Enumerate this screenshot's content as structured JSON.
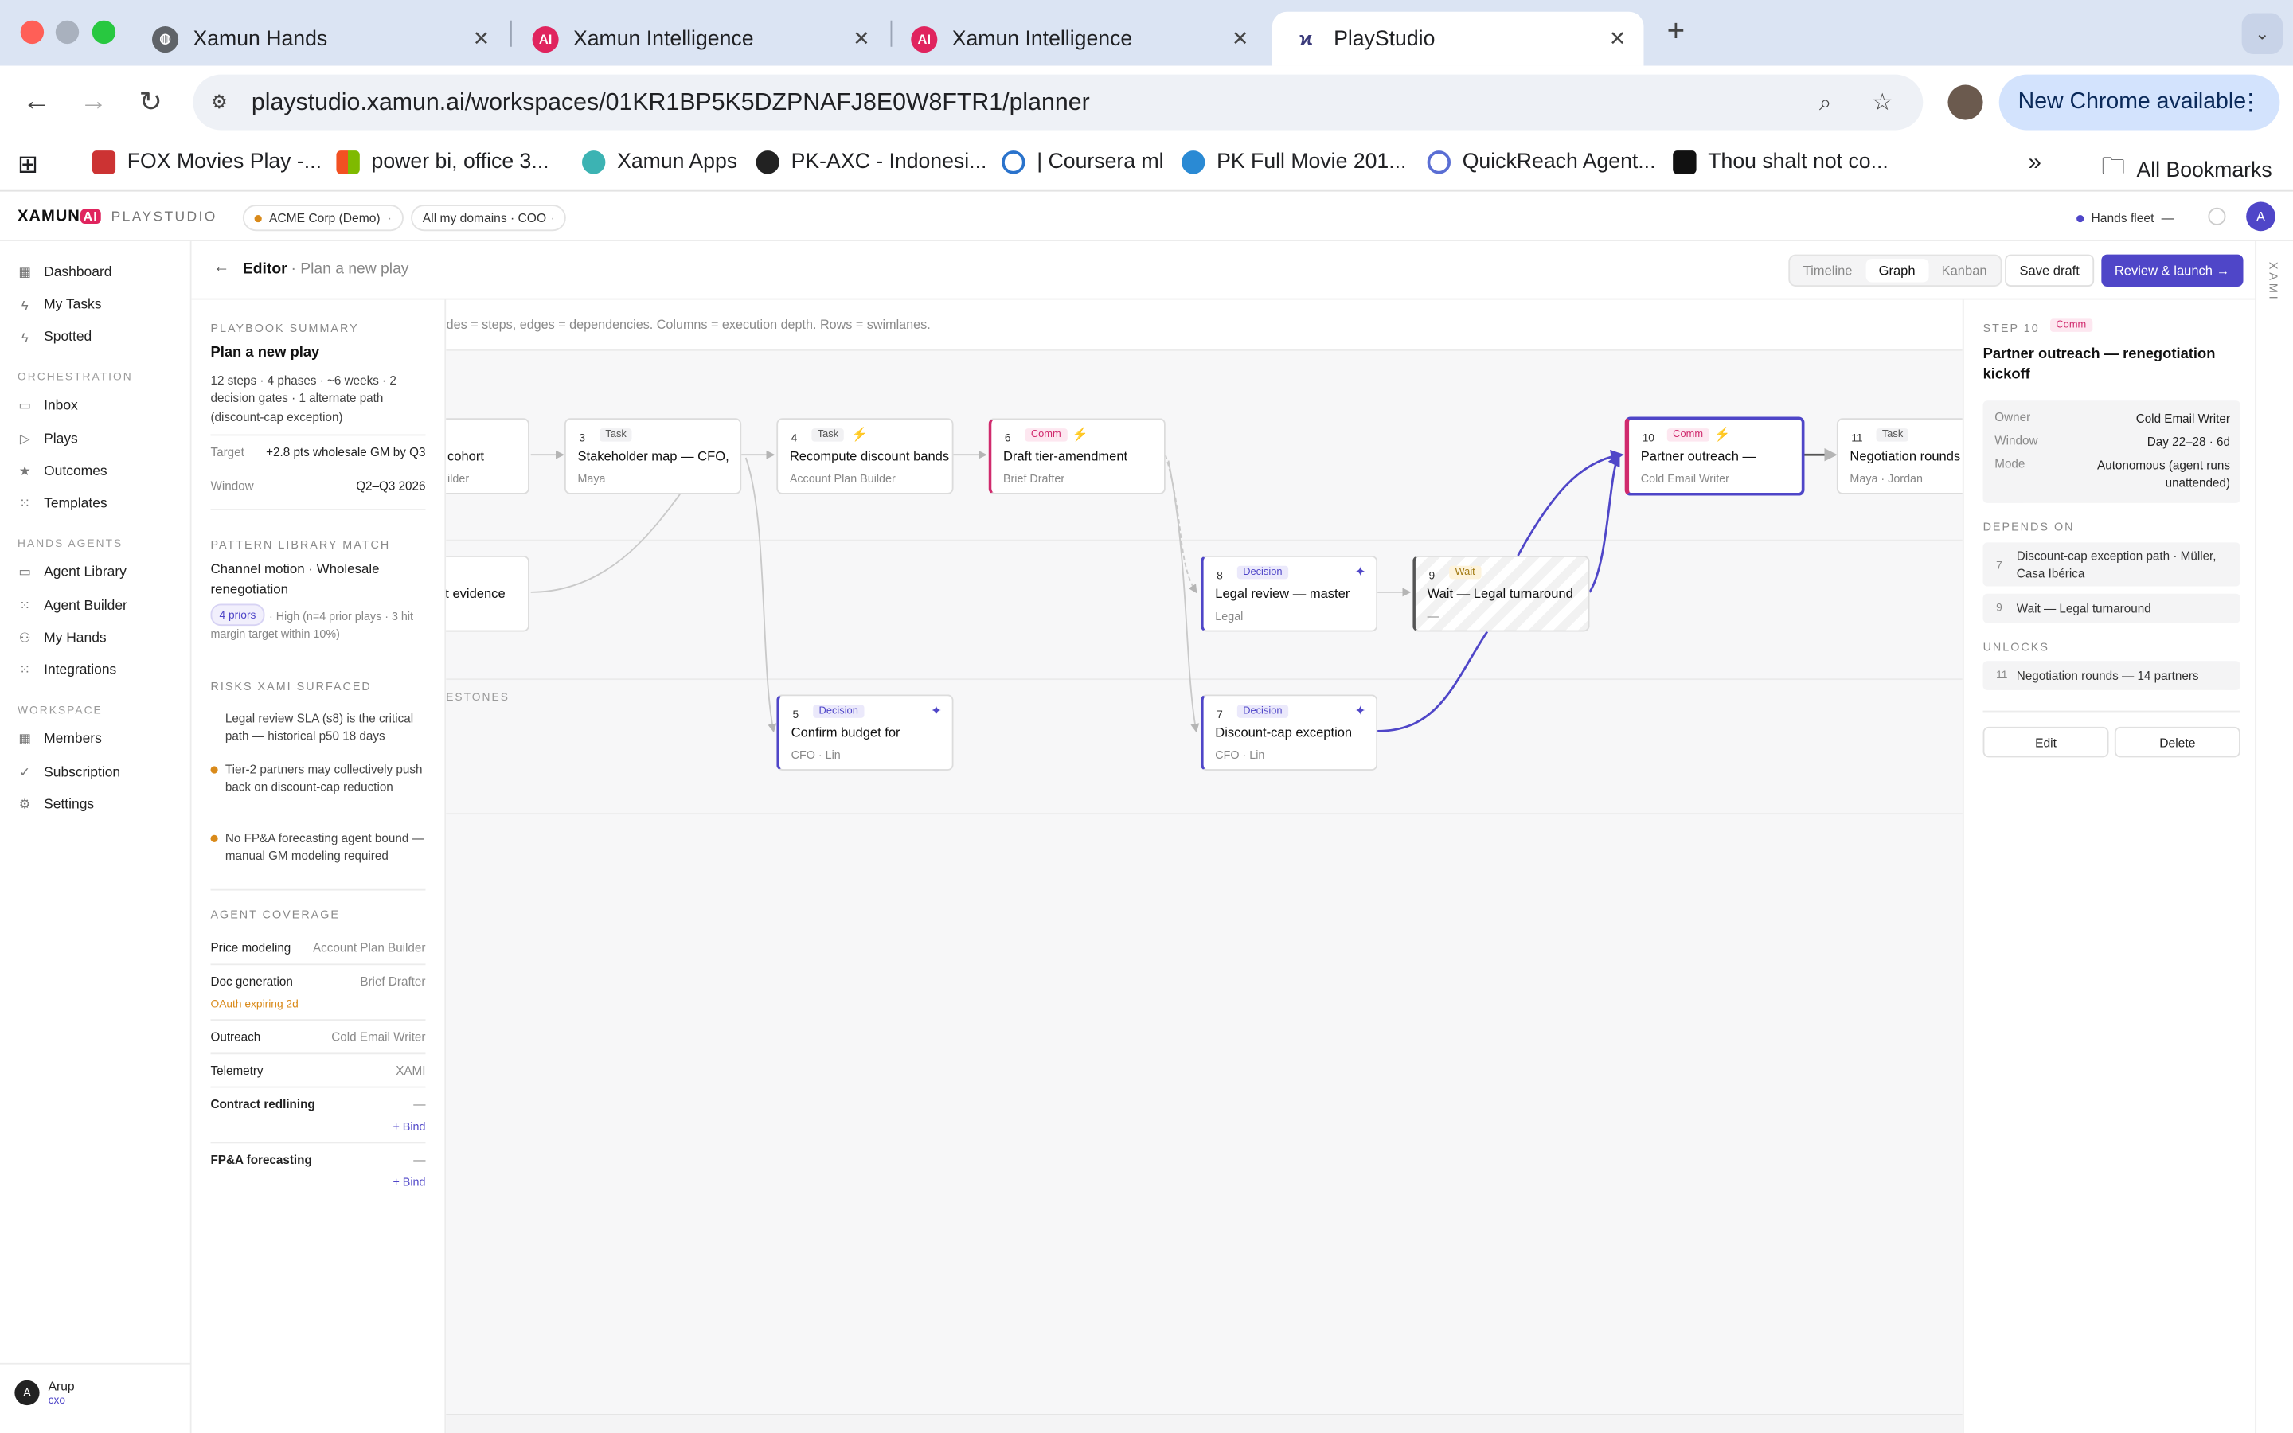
{
  "browser": {
    "tabs": [
      {
        "title": "Xamun Hands"
      },
      {
        "title": "Xamun Intelligence"
      },
      {
        "title": "Xamun Intelligence"
      },
      {
        "title": "PlayStudio"
      }
    ],
    "url": "playstudio.xamun.ai/workspaces/01KR1BP5K5DZPNAFJ8E0W8FTR1/planner",
    "new_chrome_label": "New Chrome available",
    "bookmarks": [
      "FOX Movies Play -...",
      "power bi, office 3...",
      "Xamun Apps",
      "PK-AXC - Indonesi...",
      "| Coursera ml",
      "PK Full Movie 201...",
      "QuickReach Agent...",
      "Thou shalt not co..."
    ],
    "all_bookmarks_label": "All Bookmarks"
  },
  "app": {
    "logo": "XAMUN",
    "logo_ai": "AI",
    "name": "PLAYSTUDIO",
    "org_chip": "ACME Corp (Demo)",
    "domain_chip": "All my domains · COO",
    "hands_fleet": "Hands fleet",
    "hands_fleet_value": "—",
    "avatar_letter": "A"
  },
  "sidebar": {
    "top": [
      {
        "label": "Dashboard",
        "icon": "grid-icon"
      },
      {
        "label": "My Tasks",
        "icon": "bolt-icon"
      },
      {
        "label": "Spotted",
        "icon": "bolt-icon"
      }
    ],
    "orchestration_header": "ORCHESTRATION",
    "orchestration": [
      {
        "label": "Inbox"
      },
      {
        "label": "Plays"
      },
      {
        "label": "Outcomes"
      },
      {
        "label": "Templates"
      }
    ],
    "hands_header": "HANDS AGENTS",
    "hands": [
      {
        "label": "Agent Library"
      },
      {
        "label": "Agent Builder"
      },
      {
        "label": "My Hands"
      },
      {
        "label": "Integrations"
      }
    ],
    "workspace_header": "WORKSPACE",
    "workspace": [
      {
        "label": "Members"
      },
      {
        "label": "Subscription"
      },
      {
        "label": "Settings"
      }
    ],
    "user": {
      "initial": "A",
      "name": "Arup",
      "role": "cxo"
    }
  },
  "editor": {
    "title": "Editor",
    "subtitle": "· Plan a new play",
    "views": [
      "Timeline",
      "Graph",
      "Kanban"
    ],
    "save_label": "Save draft",
    "launch_label": "Review & launch →"
  },
  "summary": {
    "header": "PLAYBOOK SUMMARY",
    "title": "Plan a new play",
    "description": "12 steps · 4 phases · ~6 weeks · 2 decision gates · 1 alternate path (discount-cap exception)",
    "target_label": "Target",
    "target_value": "+2.8 pts wholesale GM by Q3",
    "window_label": "Window",
    "window_value": "Q2–Q3 2026",
    "pattern_header": "PATTERN LIBRARY MATCH",
    "pattern_title": "Channel motion · Wholesale renegotiation",
    "priors_badge": "4 priors",
    "priors_text": "· High (n=4 prior plays · 3 hit margin target within 10%)",
    "risks_header": "RISKS XAMI SURFACED",
    "risks": [
      "Legal review SLA (s8) is the critical path — historical p50 18 days",
      "Tier-2 partners may collectively push back on discount-cap reduction",
      "No FP&A forecasting agent bound — manual GM modeling required"
    ],
    "coverage_header": "AGENT COVERAGE",
    "coverage": [
      {
        "name": "Price modeling",
        "agent": "Account Plan Builder"
      },
      {
        "name": "Doc generation",
        "agent": "Brief Drafter",
        "note": "OAuth expiring 2d"
      },
      {
        "name": "Outreach",
        "agent": "Cold Email Writer"
      },
      {
        "name": "Telemetry",
        "agent": "XAMI"
      },
      {
        "name": "Contract redlining",
        "agent": "—",
        "bind": "+ Bind"
      },
      {
        "name": "FP&A forecasting",
        "agent": "—",
        "bind": "+ Bind"
      }
    ]
  },
  "canvas": {
    "hint": "Nodes = steps, edges = dependencies. Columns = execution depth. Rows = swimlanes.",
    "lane_labels": [
      "ESTONES"
    ],
    "nodes": [
      {
        "num": "",
        "tag": "",
        "title": "cohort",
        "sub": "ilder"
      },
      {
        "num": "3",
        "tag": "Task",
        "title": "Stakeholder map — CFO,",
        "sub": "Maya"
      },
      {
        "num": "4",
        "tag": "Task",
        "title": "Recompute discount bands",
        "sub": "Account Plan Builder"
      },
      {
        "num": "6",
        "tag": "Comm",
        "title": "Draft tier-amendment",
        "sub": "Brief Drafter"
      },
      {
        "num": "10",
        "tag": "Comm",
        "title": "Partner outreach —",
        "sub": "Cold Email Writer"
      },
      {
        "num": "11",
        "tag": "Task",
        "title": "Negotiation rounds",
        "sub": "Maya · Jordan"
      },
      {
        "num": "",
        "tag": "",
        "title": "ft evidence",
        "sub": ""
      },
      {
        "num": "8",
        "tag": "Decision",
        "title": "Legal review — master",
        "sub": "Legal"
      },
      {
        "num": "9",
        "tag": "Wait",
        "title": "Wait — Legal turnaround",
        "sub": "—"
      },
      {
        "num": "5",
        "tag": "Decision",
        "title": "Confirm budget for",
        "sub": "CFO · Lin"
      },
      {
        "num": "7",
        "tag": "Decision",
        "title": "Discount-cap exception",
        "sub": "CFO · Lin"
      }
    ]
  },
  "detail": {
    "step_label": "STEP 10",
    "step_tag": "Comm",
    "title": "Partner outreach — renegotiation kickoff",
    "owner_label": "Owner",
    "owner_value": "Cold Email Writer",
    "window_label": "Window",
    "window_value": "Day 22–28 · 6d",
    "mode_label": "Mode",
    "mode_value": "Autonomous (agent runs unattended)",
    "depends_header": "DEPENDS ON",
    "depends": [
      {
        "num": "7",
        "text": "Discount-cap exception path · Müller, Casa Ibérica"
      },
      {
        "num": "9",
        "text": "Wait — Legal turnaround"
      }
    ],
    "unlocks_header": "UNLOCKS",
    "unlocks": [
      {
        "num": "11",
        "text": "Negotiation rounds — 14 partners"
      }
    ],
    "edit_label": "Edit",
    "delete_label": "Delete"
  },
  "rail": {
    "label": "XAMI"
  },
  "colors": {
    "accent": "#4f46c8",
    "comm": "#d02a6d",
    "warning": "#d97706"
  }
}
